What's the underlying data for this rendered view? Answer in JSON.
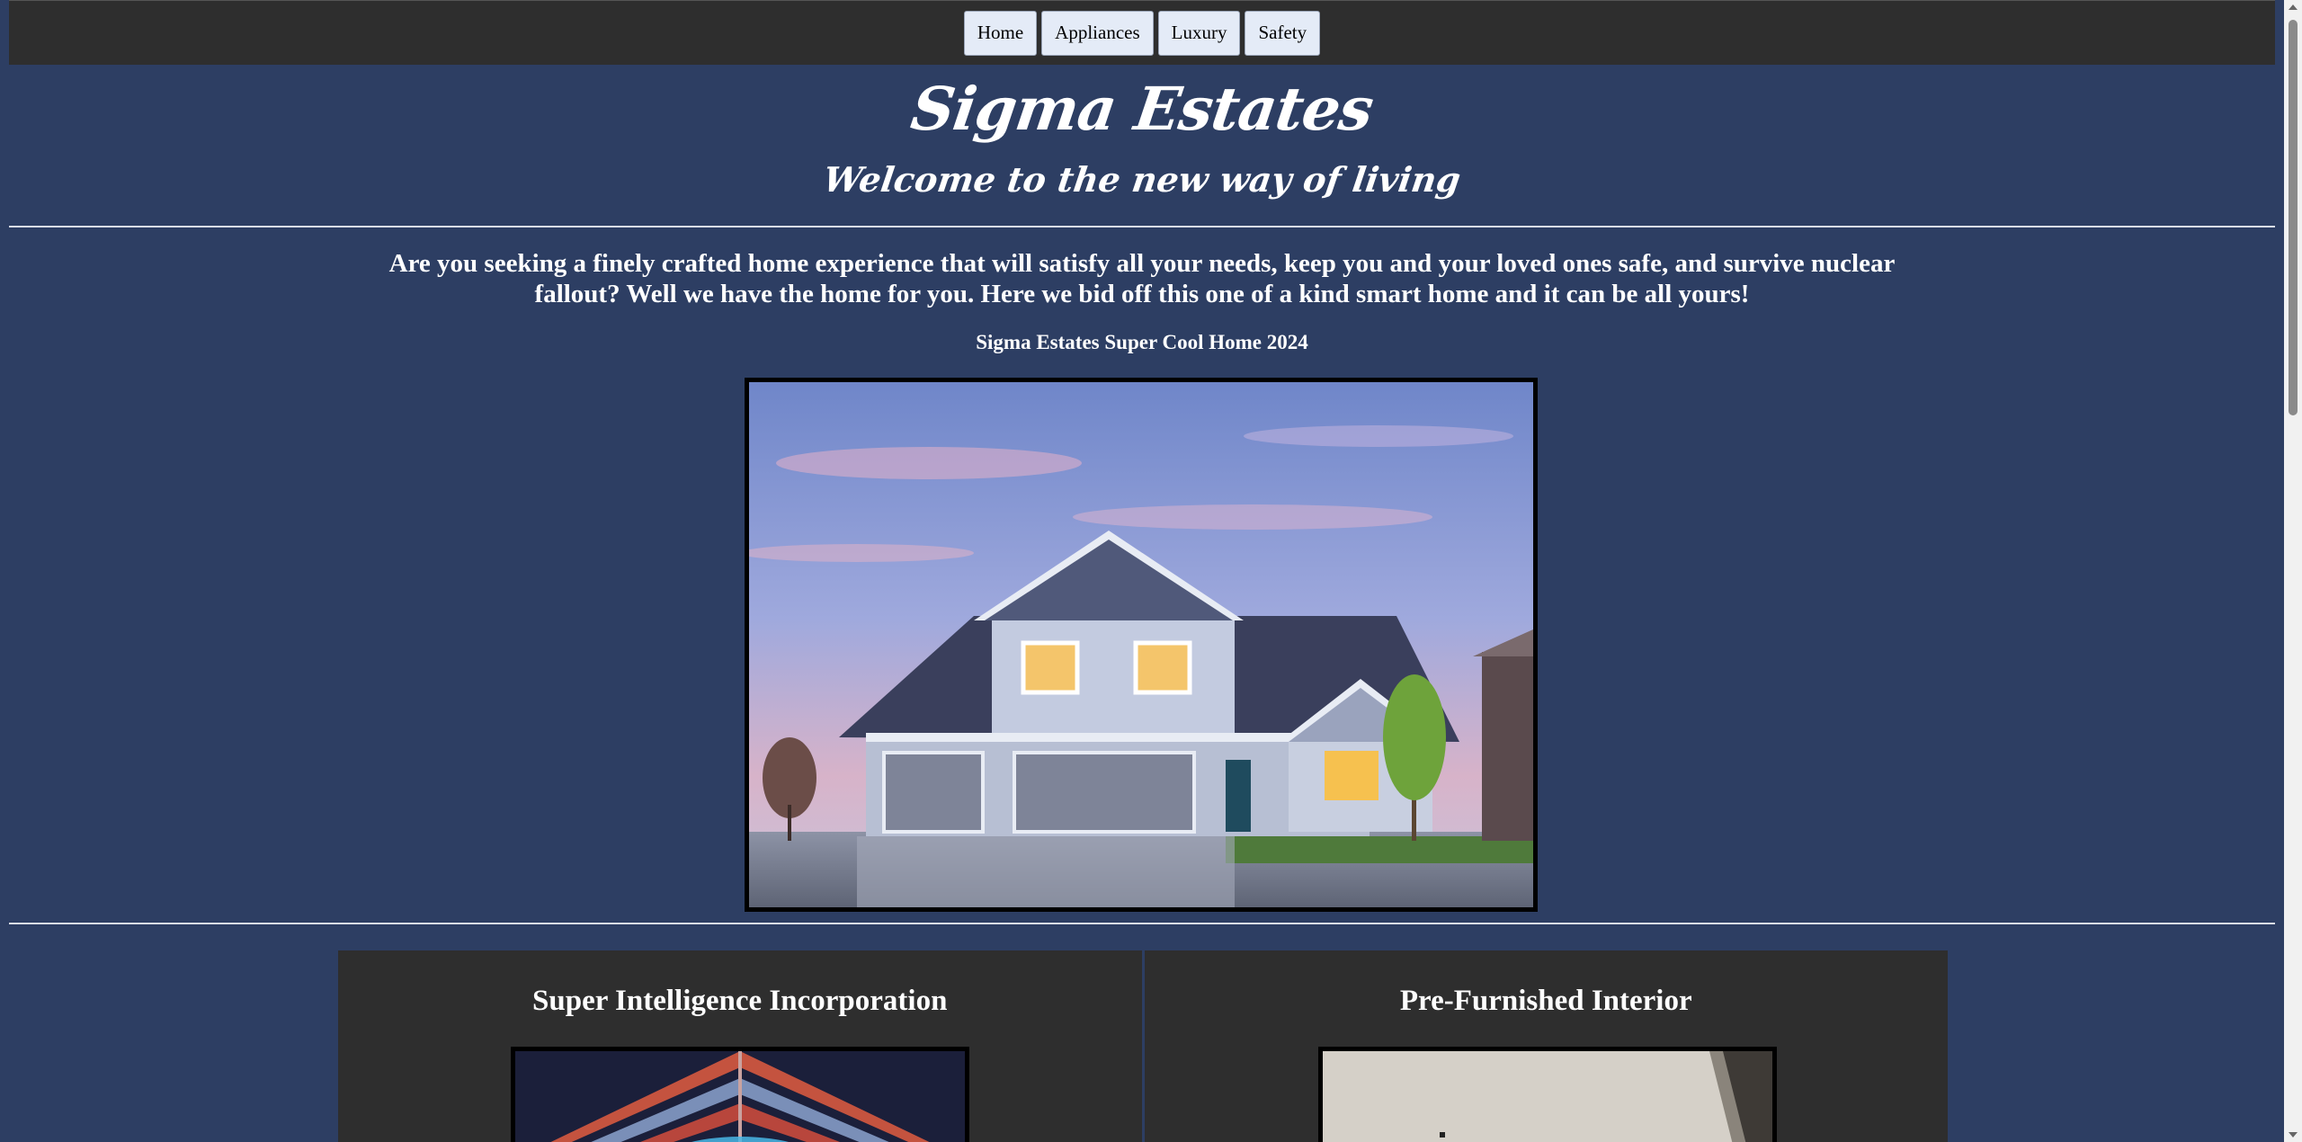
{
  "nav": {
    "items": [
      {
        "label": "Home"
      },
      {
        "label": "Appliances"
      },
      {
        "label": "Luxury"
      },
      {
        "label": "Safety"
      }
    ]
  },
  "header": {
    "title": "Sigma Estates",
    "subtitle": "Welcome to the new way of living"
  },
  "main": {
    "intro": "Are you seeking a finely crafted home experience that will satisfy all your needs, keep you and your loved ones safe, and survive nuclear fallout? Well we have the home for you. Here we bid off this one of a kind smart home and it can be all yours!",
    "caption": "Sigma Estates Super Cool Home 2024"
  },
  "features": [
    {
      "title": "Super Intelligence Incorporation"
    },
    {
      "title": "Pre-Furnished Interior"
    }
  ],
  "colors": {
    "page_bg": "#2d3e63",
    "navbar_bg": "#2e2e2e",
    "nav_button_bg": "#e4ebf7",
    "card_bg": "#2e2e2e",
    "text": "#ffffff"
  }
}
